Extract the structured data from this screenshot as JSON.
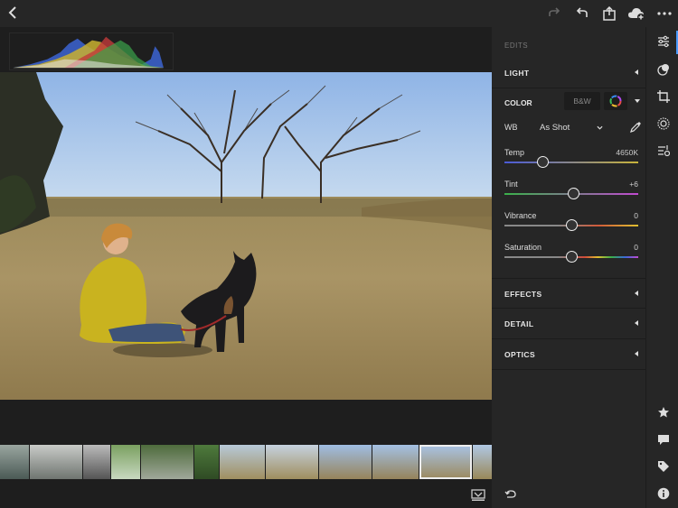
{
  "panel": {
    "title": "EDITS",
    "sections": {
      "light": "LIGHT",
      "color": "COLOR",
      "effects": "EFFECTS",
      "detail": "DETAIL",
      "optics": "OPTICS"
    },
    "color": {
      "bw_label": "B&W",
      "wb_label": "WB",
      "wb_value": "As Shot",
      "sliders": [
        {
          "label": "Temp",
          "value": "4650K",
          "level": 0.29
        },
        {
          "label": "Tint",
          "value": "+6",
          "level": 0.52
        },
        {
          "label": "Vibrance",
          "value": "0",
          "level": 0.5
        },
        {
          "label": "Saturation",
          "value": "0",
          "level": 0.5
        }
      ]
    }
  },
  "icons": {
    "back": "back-chevron-icon",
    "redo": "redo-icon",
    "undo": "undo-icon",
    "share": "share-icon",
    "cloud": "cloud-sync-icon",
    "more": "more-icon"
  },
  "colors": {
    "accent": "#4b9bff",
    "panel_bg": "#262626",
    "app_bg": "#1a1a1a"
  },
  "filmstrip": {
    "selected_index": 10,
    "count": 12
  }
}
